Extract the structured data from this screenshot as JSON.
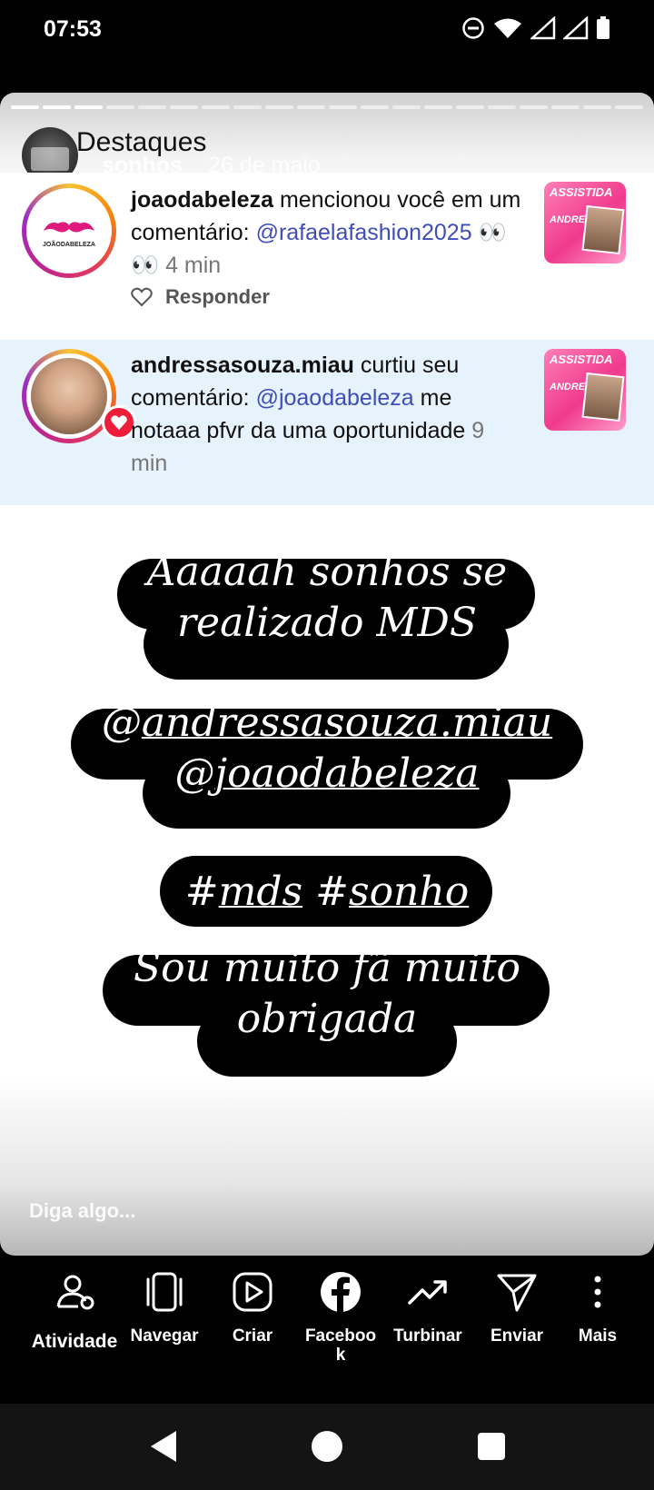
{
  "status_bar": {
    "time": "07:53"
  },
  "story": {
    "title": "Destaques",
    "username": "sonhos",
    "date": "26 de maio",
    "progress_segments_total": 20,
    "progress_segments_done": 3
  },
  "notifications": [
    {
      "username": "joaodabeleza",
      "text_1": " mencionou você em um comentário: ",
      "mention": "@rafaelafashion2025",
      "emoji": " 👀👀 ",
      "time": "4 min",
      "reply_label": "Responder",
      "avatar_brand": "JOÃODABELEZA"
    },
    {
      "username": "andressasouza.miau",
      "text_1": " curtiu seu comentário: ",
      "mention": "@joaodabeleza",
      "text_2": " me notaaa pfvr da uma oportunidade ",
      "time": "9 min"
    }
  ],
  "thumb": {
    "title": "ASSISTIDA",
    "name": "ANDRESSA"
  },
  "stickers": {
    "line1": "Aaaaah sonhos se",
    "line2": "realizado MDS",
    "mention1_prefix": "@",
    "mention1": "andressasouza.miau",
    "mention2_prefix": "@",
    "mention2": "joaodabeleza",
    "hash1_prefix": "#",
    "hash1": "mds",
    "hash2_prefix": "#",
    "hash2": "sonho",
    "line5": "Sou muito fã muito",
    "line6": "obrigada"
  },
  "reply_placeholder": "Diga algo...",
  "actions": [
    {
      "label": "Atividade",
      "icon": "activity-icon"
    },
    {
      "label": "Navegar",
      "icon": "browse-icon"
    },
    {
      "label": "Criar",
      "icon": "create-icon"
    },
    {
      "label_line1": "Faceboo",
      "label_line2": "k",
      "icon": "facebook-icon"
    },
    {
      "label": "Turbinar",
      "icon": "boost-icon"
    },
    {
      "label": "Enviar",
      "icon": "send-icon"
    },
    {
      "label": "Mais",
      "icon": "more-icon"
    }
  ]
}
